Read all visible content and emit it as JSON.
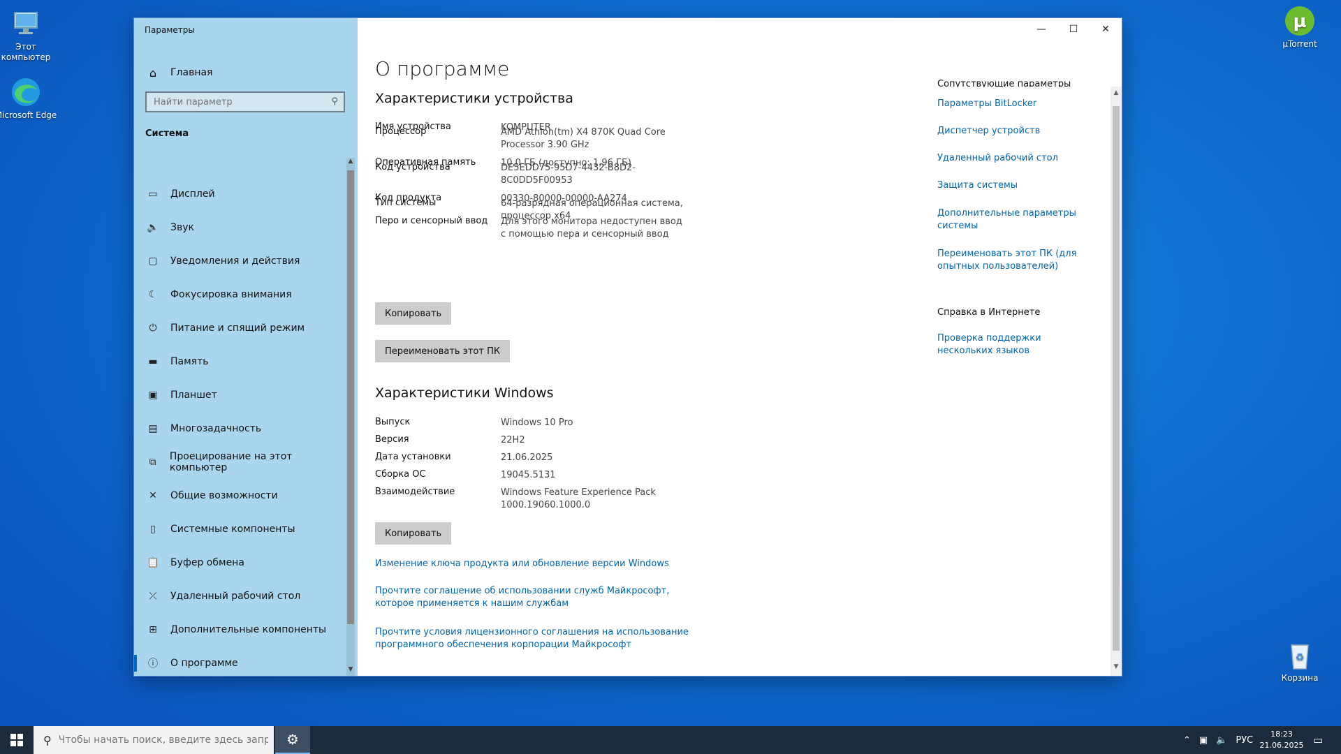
{
  "desktop": {
    "icons": [
      {
        "label": "Этот компьютер"
      },
      {
        "label": "Microsoft Edge"
      },
      {
        "label": "µTorrent"
      },
      {
        "label": "Корзина"
      }
    ]
  },
  "window": {
    "title": "Параметры",
    "controls": {
      "minimize": "—",
      "maximize": "☐",
      "close": "✕"
    }
  },
  "sidebar": {
    "home_label": "Главная",
    "search_placeholder": "Найти параметр",
    "section": "Система",
    "items": [
      {
        "label": "Дисплей",
        "icon": "display-icon"
      },
      {
        "label": "Звук",
        "icon": "sound-icon"
      },
      {
        "label": "Уведомления и действия",
        "icon": "notifications-icon"
      },
      {
        "label": "Фокусировка внимания",
        "icon": "focus-assist-icon"
      },
      {
        "label": "Питание и спящий режим",
        "icon": "power-icon"
      },
      {
        "label": "Память",
        "icon": "storage-icon"
      },
      {
        "label": "Планшет",
        "icon": "tablet-icon"
      },
      {
        "label": "Многозадачность",
        "icon": "multitasking-icon"
      },
      {
        "label": "Проецирование на этот компьютер",
        "icon": "projecting-icon"
      },
      {
        "label": "Общие возможности",
        "icon": "shared-experiences-icon"
      },
      {
        "label": "Системные компоненты",
        "icon": "system-components-icon"
      },
      {
        "label": "Буфер обмена",
        "icon": "clipboard-icon"
      },
      {
        "label": "Удаленный рабочий стол",
        "icon": "remote-desktop-icon"
      },
      {
        "label": "Дополнительные компоненты",
        "icon": "optional-features-icon"
      },
      {
        "label": "О программе",
        "icon": "info-icon"
      }
    ]
  },
  "main": {
    "page_title": "О программе",
    "device_heading": "Характеристики устройства",
    "device_specs": [
      {
        "key": "Имя устройства",
        "value": "KOMPUTER"
      },
      {
        "key": "Процессор",
        "value": "AMD Athlon(tm) X4 870K Quad Core Processor     3.90 GHz"
      },
      {
        "key": "Оперативная память",
        "value": "10,0 ГБ (доступно: 1,96 ГБ)"
      },
      {
        "key": "Код устройства",
        "value": "DE5EDD75-95D7-4432-B8D2-8C0DD5F00953"
      },
      {
        "key": "Код продукта",
        "value": "00330-80000-00000-AA274"
      },
      {
        "key": "Тип системы",
        "value": "64-разрядная операционная система, процессор x64"
      },
      {
        "key": "Перо и сенсорный ввод",
        "value": "Для этого монитора недоступен ввод с помощью пера и сенсорный ввод"
      }
    ],
    "copy_label": "Копировать",
    "rename_label": "Переименовать этот ПК",
    "windows_heading": "Характеристики Windows",
    "windows_specs": [
      {
        "key": "Выпуск",
        "value": "Windows 10 Pro"
      },
      {
        "key": "Версия",
        "value": "22H2"
      },
      {
        "key": "Дата установки",
        "value": "21.06.2025"
      },
      {
        "key": "Сборка ОС",
        "value": "19045.5131"
      },
      {
        "key": "Взаимодействие",
        "value": "Windows Feature Experience Pack 1000.19060.1000.0"
      }
    ],
    "links": [
      "Изменение ключа продукта или обновление версии Windows",
      "Прочтите соглашение об использовании служб Майкрософт, которое применяется к нашим службам",
      "Прочтите условия лицензионного соглашения на использование программного обеспечения корпорации Майкрософт"
    ]
  },
  "related": {
    "heading": "Сопутствующие параметры",
    "links": [
      "Параметры BitLocker",
      "Диспетчер устройств",
      "Удаленный рабочий стол",
      "Защита системы",
      "Дополнительные параметры системы",
      "Переименовать этот ПК (для опытных пользователей)"
    ],
    "help_heading": "Справка в Интернете",
    "help_links": [
      "Проверка поддержки нескольких языков"
    ]
  },
  "taskbar": {
    "search_placeholder": "Чтобы начать поиск, введите здесь запрос",
    "language": "РУС",
    "time": "18:23",
    "date": "21.06.2025"
  }
}
